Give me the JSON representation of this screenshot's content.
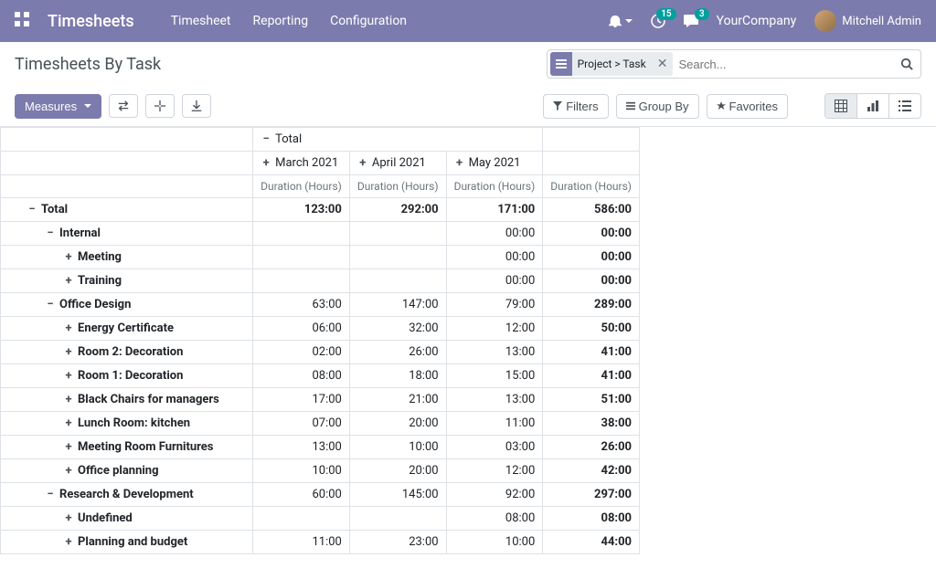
{
  "navbar": {
    "brand": "Timesheets",
    "links": [
      "Timesheet",
      "Reporting",
      "Configuration"
    ],
    "activity_count": "15",
    "msg_count": "3",
    "company": "YourCompany",
    "user": "Mitchell Admin"
  },
  "control_panel": {
    "breadcrumb": "Timesheets By Task",
    "facet": "Project > Task",
    "search_placeholder": "Search...",
    "measures_label": "Measures",
    "filters_label": "Filters",
    "groupby_label": "Group By",
    "favorites_label": "Favorites"
  },
  "pivot": {
    "total_label": "Total",
    "months": [
      "March 2021",
      "April 2021",
      "May 2021"
    ],
    "measure_label": "Duration (Hours)",
    "rows": [
      {
        "label": "Total",
        "expanded": true,
        "indent": 0,
        "cells": [
          "123:00",
          "292:00",
          "171:00",
          "586:00"
        ],
        "bold": true
      },
      {
        "label": "Internal",
        "expanded": true,
        "indent": 1,
        "cells": [
          "",
          "",
          "00:00",
          "00:00"
        ]
      },
      {
        "label": "Meeting",
        "expanded": false,
        "indent": 2,
        "cells": [
          "",
          "",
          "00:00",
          "00:00"
        ]
      },
      {
        "label": "Training",
        "expanded": false,
        "indent": 2,
        "cells": [
          "",
          "",
          "00:00",
          "00:00"
        ]
      },
      {
        "label": "Office Design",
        "expanded": true,
        "indent": 1,
        "cells": [
          "63:00",
          "147:00",
          "79:00",
          "289:00"
        ]
      },
      {
        "label": "Energy Certificate",
        "expanded": false,
        "indent": 2,
        "cells": [
          "06:00",
          "32:00",
          "12:00",
          "50:00"
        ]
      },
      {
        "label": "Room 2: Decoration",
        "expanded": false,
        "indent": 2,
        "cells": [
          "02:00",
          "26:00",
          "13:00",
          "41:00"
        ]
      },
      {
        "label": "Room 1: Decoration",
        "expanded": false,
        "indent": 2,
        "cells": [
          "08:00",
          "18:00",
          "15:00",
          "41:00"
        ]
      },
      {
        "label": "Black Chairs for managers",
        "expanded": false,
        "indent": 2,
        "cells": [
          "17:00",
          "21:00",
          "13:00",
          "51:00"
        ]
      },
      {
        "label": "Lunch Room: kitchen",
        "expanded": false,
        "indent": 2,
        "cells": [
          "07:00",
          "20:00",
          "11:00",
          "38:00"
        ]
      },
      {
        "label": "Meeting Room Furnitures",
        "expanded": false,
        "indent": 2,
        "cells": [
          "13:00",
          "10:00",
          "03:00",
          "26:00"
        ]
      },
      {
        "label": "Office planning",
        "expanded": false,
        "indent": 2,
        "cells": [
          "10:00",
          "20:00",
          "12:00",
          "42:00"
        ]
      },
      {
        "label": "Research & Development",
        "expanded": true,
        "indent": 1,
        "cells": [
          "60:00",
          "145:00",
          "92:00",
          "297:00"
        ]
      },
      {
        "label": "Undefined",
        "expanded": false,
        "indent": 2,
        "cells": [
          "",
          "",
          "08:00",
          "08:00"
        ]
      },
      {
        "label": "Planning and budget",
        "expanded": false,
        "indent": 2,
        "cells": [
          "11:00",
          "23:00",
          "10:00",
          "44:00"
        ]
      }
    ]
  }
}
